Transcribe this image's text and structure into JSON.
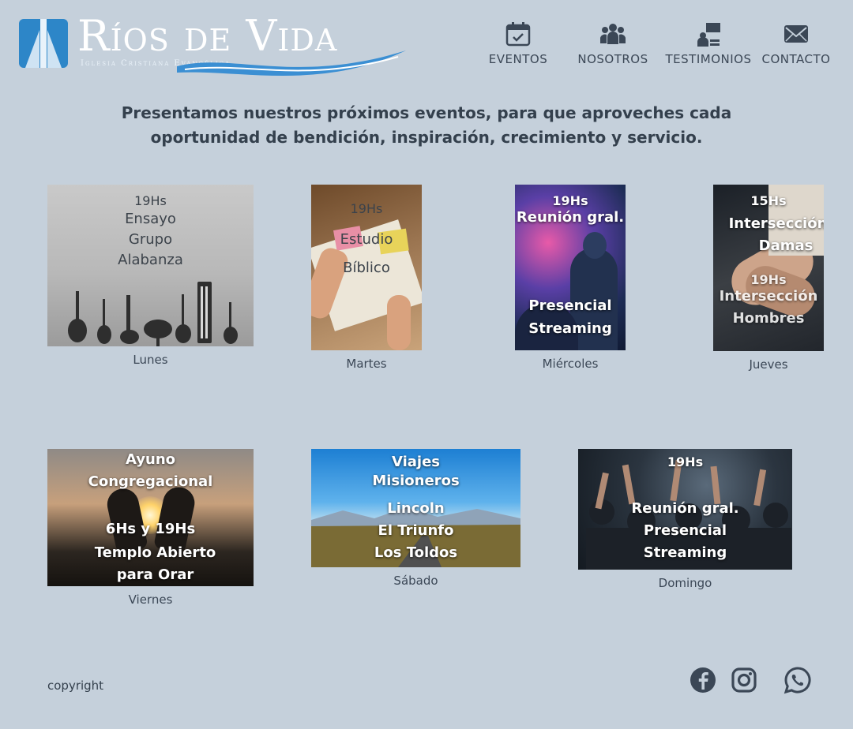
{
  "brand": {
    "name": "Ríos de Vida",
    "tagline": "Iglesia Cristiana Evangélica",
    "accent": "#2d86c8"
  },
  "nav": {
    "items": [
      {
        "label": "EVENTOS",
        "icon": "calendar-check-icon"
      },
      {
        "label": "NOSOTROS",
        "icon": "people-group-icon"
      },
      {
        "label": "TESTIMONIOS",
        "icon": "person-speaking-icon"
      },
      {
        "label": "CONTACTO",
        "icon": "envelope-icon"
      }
    ]
  },
  "intro": "Presentamos nuestros próximos eventos, para que aproveches cada oportunidad de bendición, inspiración, crecimiento y servicio.",
  "events": {
    "lunes": {
      "day": "Lunes",
      "time": "19Hs",
      "title": [
        "Ensayo",
        "Grupo",
        "Alabanza"
      ],
      "image": "musical-instruments-photo"
    },
    "martes": {
      "day": "Martes",
      "time": "19Hs",
      "title": [
        "Estudio",
        "Bíblico"
      ],
      "image": "bible-study-photo"
    },
    "miercoles": {
      "day": "Miércoles",
      "time": "19Hs",
      "title": "Reunión gral.",
      "modes": [
        "Presencial",
        "Streaming"
      ],
      "image": "congregation-photo"
    },
    "jueves": {
      "day": "Jueves",
      "time1": "15Hs",
      "title1": [
        "Intersección",
        "Damas"
      ],
      "time2": "19Hs",
      "title2": [
        "Intersección",
        "Hombres"
      ],
      "image": "praying-hands-photo"
    },
    "viernes": {
      "day": "Viernes",
      "title": [
        "Ayuno",
        "Congregacional"
      ],
      "time": "6Hs y 19Hs",
      "subtitle": [
        "Templo Abierto",
        "para Orar"
      ],
      "image": "sunset-hands-photo"
    },
    "sabado": {
      "day": "Sábado",
      "title": [
        "Viajes",
        "Misioneros"
      ],
      "places": [
        "Lincoln",
        "El Triunfo",
        "Los Toldos"
      ],
      "image": "landscape-road-photo"
    },
    "domingo": {
      "day": "Domingo",
      "time": "19Hs",
      "title": "Reunión gral.",
      "modes": [
        "Presencial",
        "Streaming"
      ],
      "image": "worship-crowd-photo"
    }
  },
  "footer": {
    "copyright": "copyright",
    "social": [
      {
        "icon": "facebook-icon"
      },
      {
        "icon": "instagram-icon"
      },
      {
        "icon": "whatsapp-icon"
      }
    ]
  }
}
